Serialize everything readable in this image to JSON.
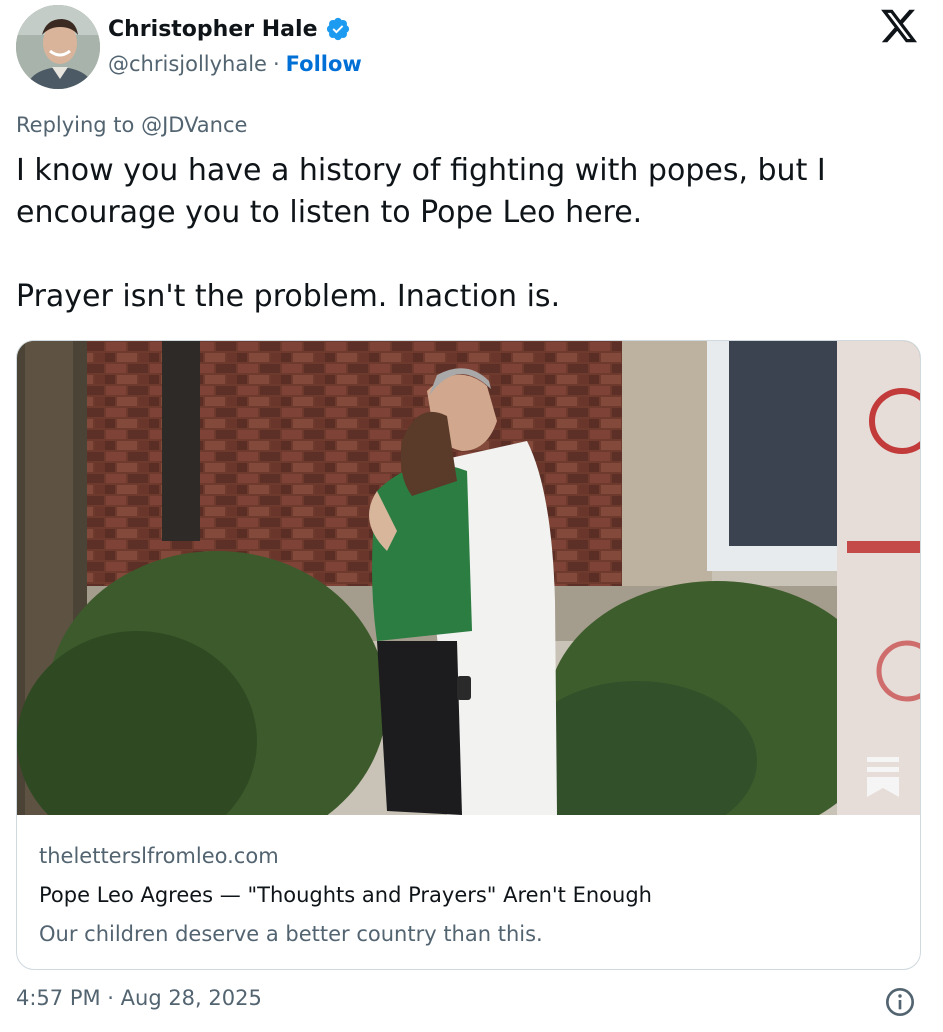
{
  "author": {
    "display_name": "Christopher Hale",
    "handle": "@chrisjollyhale",
    "separator": "·",
    "follow_label": "Follow",
    "verified": true,
    "verified_color": "#1d9bf0"
  },
  "brand": {
    "logo": "x-logo-icon"
  },
  "reply": {
    "prefix": "Replying to ",
    "mention": "@JDVance"
  },
  "tweet": {
    "paragraphs": [
      "I know you have a history of fighting with popes, but I encourage you to listen to Pope Leo here.",
      "Prayer isn't the problem. Inaction is."
    ]
  },
  "card": {
    "image_icon": "substack-bookmark-icon",
    "domain": "theletterslfromleo.com",
    "title": "Pope Leo Agrees — \"Thoughts and Prayers\" Aren't Enough",
    "description": "Our children deserve a better country than this."
  },
  "footer": {
    "timestamp": "4:57 PM · Aug 28, 2025",
    "info_icon": "info-icon"
  },
  "colors": {
    "text_primary": "#0f1419",
    "text_secondary": "#536471",
    "link": "#006fd6",
    "border": "#cfd9de"
  }
}
